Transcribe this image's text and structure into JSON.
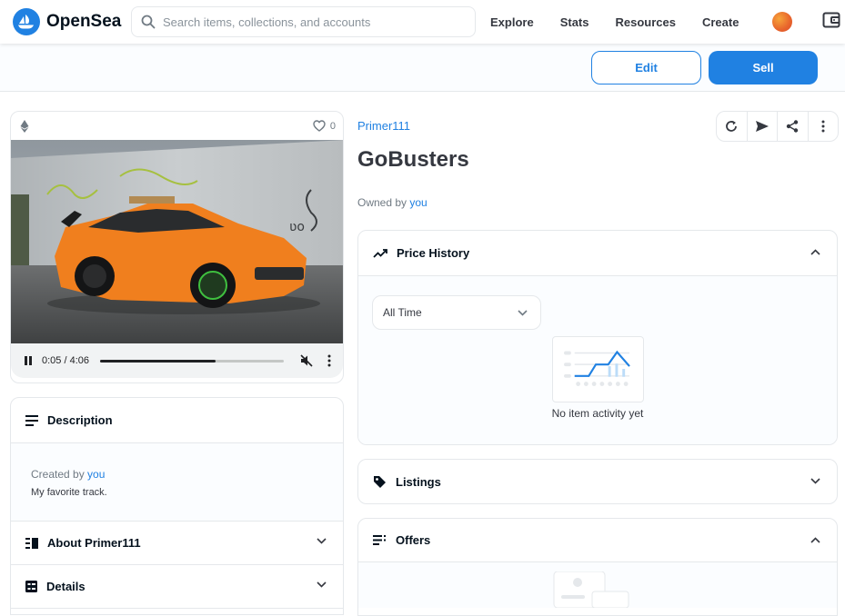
{
  "nav": {
    "logo_text": "OpenSea",
    "search_placeholder": "Search items, collections, and accounts",
    "links": [
      "Explore",
      "Stats",
      "Resources",
      "Create"
    ]
  },
  "actions": {
    "edit_label": "Edit",
    "sell_label": "Sell"
  },
  "media": {
    "chain_icon": "ethereum-icon",
    "favorites_count": "0",
    "player": {
      "time": "0:05 / 4:06",
      "progress_fraction": 0.63
    }
  },
  "description": {
    "title": "Description",
    "created_by_prefix": "Created by",
    "created_by_user": "you",
    "text": "My favorite track."
  },
  "about": {
    "title": "About Primer111"
  },
  "details": {
    "title": "Details"
  },
  "item": {
    "collection": "Primer111",
    "title": "GoBusters",
    "owned_by_prefix": "Owned by",
    "owner": "you"
  },
  "price_history": {
    "title": "Price History",
    "range": "All Time",
    "empty_text": "No item activity yet"
  },
  "listings": {
    "title": "Listings"
  },
  "offers": {
    "title": "Offers"
  },
  "colors": {
    "accent": "#2081e2",
    "border": "#e5e8eb",
    "car": "#f07f1e"
  }
}
